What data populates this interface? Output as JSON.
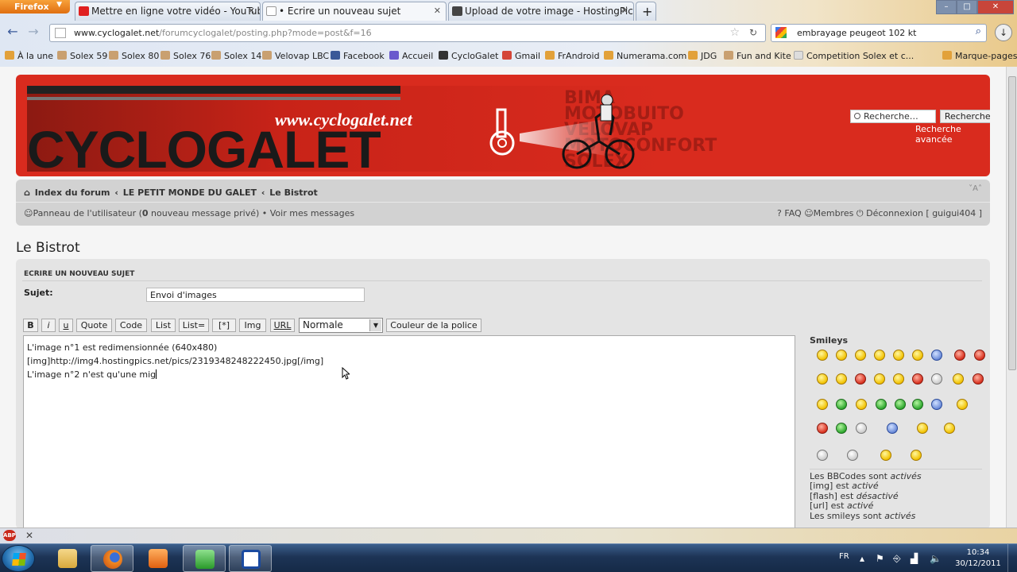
{
  "browser": {
    "menu_button": "Firefox",
    "tabs": [
      {
        "label": "Mettre en ligne votre vidéo - YouTube",
        "active": false
      },
      {
        "label": "• Ecrire un nouveau sujet",
        "active": true
      },
      {
        "label": "Upload de votre image - HostingPics....",
        "active": false
      }
    ],
    "new_tab": "+",
    "window_controls": {
      "minimize": "–",
      "maximize": "□",
      "close": "✕"
    },
    "url_domain": "www.cyclogalet.net",
    "url_path": "/forumcyclogalet/posting.php?mode=post&f=16",
    "search_value": "embrayage peugeot 102 kt",
    "bookmarks": [
      "À la une",
      "Solex 59",
      "Solex 80",
      "Solex 76",
      "Solex 14",
      "Velovap LBC",
      "Facebook",
      "Accueil",
      "CycloGalet",
      "Gmail",
      "FrAndroid",
      "Numerama.com",
      "JDG",
      "Fun and Kite",
      "Competition Solex et c...",
      "Marque-pages"
    ],
    "status_close": "✕"
  },
  "forum": {
    "banner": {
      "url_text": "www.cyclogalet.net",
      "logo_text": "CYCLOGALET",
      "words": [
        "BIMA",
        "MOTOBUITO",
        "VELOVAP",
        "MOTOCONFORT",
        "SOLEX"
      ]
    },
    "header_search": {
      "placeholder": "Recherche…",
      "button": "Rechercher",
      "advanced": "Recherche avancée"
    },
    "breadcrumb": [
      "Index du forum",
      "LE PETIT MONDE DU GALET",
      "Le Bistrot"
    ],
    "breadcrumb_sep": "‹",
    "font_resize": "A",
    "user_panel": {
      "panel_label": "Panneau de l'utilisateur (",
      "pm_count": "0",
      "pm_label": " nouveau message privé) • Voir mes messages"
    },
    "right_links": {
      "faq": "FAQ",
      "members": "Membres",
      "logout": "Déconnexion [ guigui404 ]"
    },
    "page_title": "Le Bistrot",
    "post": {
      "heading": "Ecrire un nouveau sujet",
      "subject_label": "Sujet:",
      "subject_value": "Envoi d'images",
      "toolbar": [
        "B",
        "i",
        "u",
        "Quote",
        "Code",
        "List",
        "List=",
        "[*]",
        "Img",
        "URL"
      ],
      "size_select": "Normale",
      "color_button": "Couleur de la police",
      "body_lines": [
        "L'image n°1 est redimensionnée (640x480)",
        "",
        "[img]http://img4.hostingpics.net/pics/2319348248222450.jpg[/img]",
        "",
        "L'image n°2 n'est qu'une mig"
      ]
    },
    "smileys": {
      "title": "Smileys",
      "count": 39
    },
    "bbcode_status": [
      {
        "text": "Les BBCodes sont ",
        "state": "activés"
      },
      {
        "text": "[img] est ",
        "state": "activé"
      },
      {
        "text": "[flash] est ",
        "state": "désactivé"
      },
      {
        "text": "[url] est ",
        "state": "activé"
      },
      {
        "text": "Les smileys sont ",
        "state": "activés"
      }
    ]
  },
  "statusbar": {
    "addon_badge": "ABP"
  },
  "taskbar": {
    "language": "FR",
    "time": "10:34",
    "date": "30/12/2011"
  }
}
